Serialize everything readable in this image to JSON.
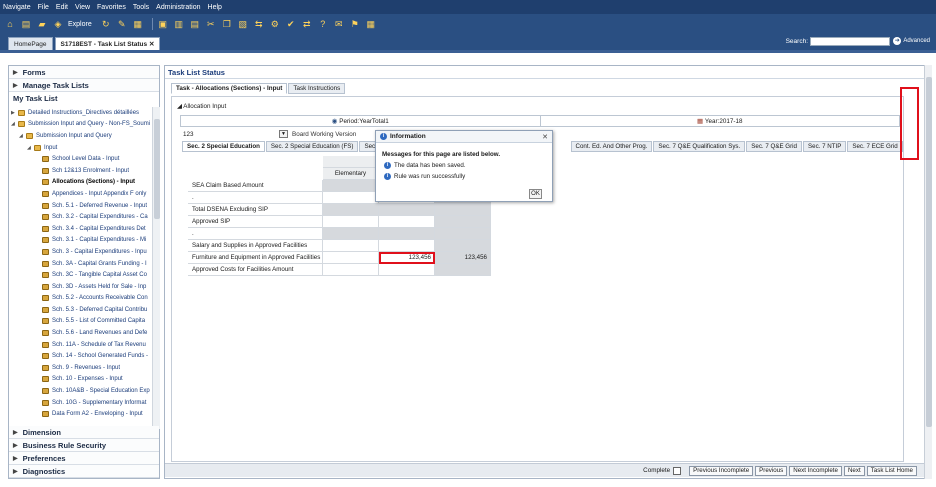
{
  "menu": [
    "Navigate",
    "File",
    "Edit",
    "View",
    "Favorites",
    "Tools",
    "Administration",
    "Help"
  ],
  "toolbar": {
    "explore_label": "Explore"
  },
  "tabs": [
    {
      "label": "HomePage"
    },
    {
      "label": "S1718EST - Task List Status"
    }
  ],
  "search": {
    "label": "Search:",
    "advanced": "Advanced"
  },
  "left_panel": {
    "forms": "Forms",
    "manage_task_lists": "Manage Task Lists",
    "my_task_list": "My Task List",
    "tree": [
      "Detailed Instructions_Directives détaillées",
      "Submission Input and Query - Non-FS_Soumi",
      "Submission Input and Query",
      "Input",
      "School Level Data - Input",
      "Sch 12&13 Enrolment - Input",
      "Allocations (Sections) - Input",
      "Appendices - Input Appendix F only",
      "Sch. 5.1 - Deferred Revenue - Input",
      "Sch. 3.2 - Capital Expenditures - Ca",
      "Sch. 3.4 - Capital Expenditures Det",
      "Sch. 3.1 - Capital Expenditures - Mi",
      "Sch. 3 - Capital Expenditures - Inpu",
      "Sch. 3A - Capital Grants Funding - I",
      "Sch. 3C - Tangible Capital Asset Co",
      "Sch. 3D - Assets Held for Sale - Inp",
      "Sch. 5.2 - Accounts Receivable Con",
      "Sch. 5.3 - Deferred Capital Contribu",
      "Sch. 5.5 - List of Committed Capita",
      "Sch. 5.6 - Land Revenues and Defe",
      "Sch. 11A - Schedule of Tax Revenu",
      "Sch. 14 - School Generated Funds -",
      "Sch. 9 - Revenues - Input",
      "Sch. 10 - Expenses - Input",
      "Sch. 10A&B - Special Education Exp",
      "Sch. 10G - Supplementary Informat",
      "Data Form A2 - Enveloping - Input"
    ],
    "bottom": [
      "Dimension",
      "Business Rule Security",
      "Preferences",
      "Diagnostics"
    ]
  },
  "content": {
    "title": "Task List Status",
    "subtabs": [
      "Task - Allocations (Sections) - Input",
      "Task Instructions"
    ],
    "form_name": "Allocation Input",
    "pov": {
      "period": "Period:YearTotal1",
      "year": "Year:2017-18"
    },
    "row_member": "123",
    "row_dropdown": "Board Working Version",
    "grid_tabs": [
      "Sec. 2 Special Education",
      "Sec. 2 Special Education (FS)",
      "Sec. 3 F",
      "Cont. Ed. And Other Prog.",
      "Sec. 7 Q&E Qualification Sys.",
      "Sec. 7 Q&E Grid",
      "Sec. 7 NTIP",
      "Sec. 7 ECE Grid"
    ],
    "col_header": "Elementary",
    "rows": [
      {
        "label": "SEA Claim Based Amount",
        "c1": "",
        "c2": "",
        "c3": ""
      },
      {
        "label": ".",
        "c1": "",
        "c2": "",
        "c3": ""
      },
      {
        "label": "Total DSENA Excluding SIP",
        "c1": "",
        "c2": "",
        "c3": ""
      },
      {
        "label": "Approved SIP",
        "c1": "",
        "c2": "",
        "c3": ""
      },
      {
        "label": ".",
        "c1": "",
        "c2": "",
        "c3": ""
      },
      {
        "label": "Salary and Supplies in Approved Facilities",
        "c1": "",
        "c2": "",
        "c3": ""
      },
      {
        "label": "Furniture and Equipment in Approved Facilities",
        "c1": "",
        "c2": "123,456",
        "c3": "123,456"
      },
      {
        "label": "Approved Costs for Facilities Amount",
        "c1": "",
        "c2": "",
        "c3": ""
      }
    ]
  },
  "dialog": {
    "title": "Information",
    "heading": "Messages for this page are listed below.",
    "messages": [
      "The data has been saved.",
      "Rule was run successfully"
    ],
    "ok": "OK"
  },
  "bottombar": {
    "complete": "Complete",
    "buttons": [
      "Previous Incomplete",
      "Previous",
      "Next Incomplete",
      "Next",
      "Task List Home"
    ]
  },
  "colors": {
    "accent": "#2a4f82",
    "highlight": "#e0101b"
  }
}
